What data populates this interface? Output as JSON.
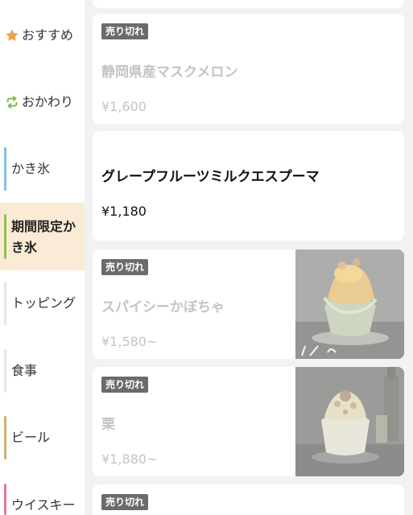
{
  "sidebar": {
    "items": [
      {
        "label": "おすすめ",
        "icon": "star-icon"
      },
      {
        "label": "おかわり",
        "icon": "repeat-icon"
      },
      {
        "label": "かき氷"
      },
      {
        "label": "期間限定かき氷"
      },
      {
        "label": "トッピング"
      },
      {
        "label": "食事"
      },
      {
        "label": "ビール"
      },
      {
        "label": "ウイスキー"
      }
    ],
    "colors": {
      "star": "#f0a04b",
      "repeat": "#7bbf4a",
      "kakigori_bar": "#7fc1e0",
      "limited_bar": "#8cc152",
      "topping_bar": "#e5e5e5",
      "meal_bar": "#e5e5e5",
      "beer_bar": "#c9b26b",
      "whisky_bar": "#e57aa3",
      "active_bg": "#fbebd6"
    }
  },
  "menu": {
    "items": [
      {
        "badge": "売り切れ",
        "name": "静岡県産マスクメロン",
        "price": "¥1,600",
        "sold_out": true
      },
      {
        "name": "グレープフルーツミルクエスプーマ",
        "price": "¥1,180",
        "sold_out": false
      },
      {
        "badge": "売り切れ",
        "name": "スパイシーかぼちゃ",
        "price": "¥1,580~",
        "sold_out": true,
        "image": "kabocha-shaved-ice"
      },
      {
        "badge": "売り切れ",
        "name": "栗",
        "price": "¥1,880~",
        "sold_out": true,
        "image": "chestnut-shaved-ice"
      },
      {
        "badge": "売り切れ"
      }
    ]
  }
}
